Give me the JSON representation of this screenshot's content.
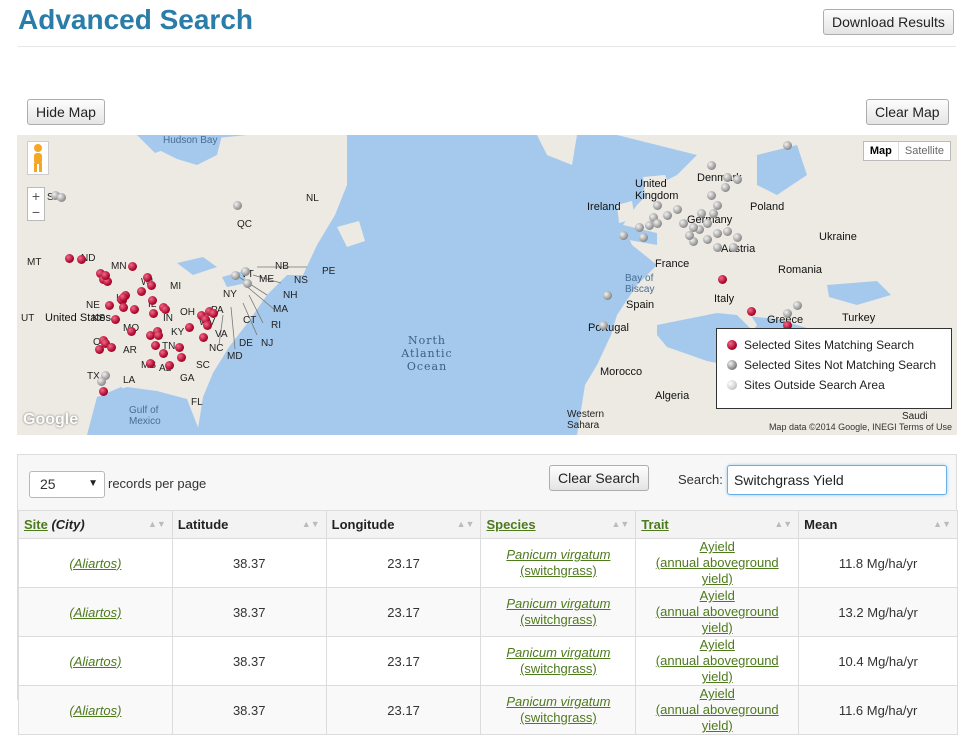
{
  "header": {
    "title": "Advanced Search",
    "download_label": "Download Results"
  },
  "map_toolbar": {
    "hide_label": "Hide Map",
    "clear_label": "Clear Map"
  },
  "map": {
    "map_type": {
      "map": "Map",
      "satellite": "Satellite"
    },
    "zoom_in": "+",
    "zoom_out": "−",
    "attribution": "Map data ©2014 Google, INEGI   Terms of Use",
    "logo": "Google",
    "labels": {
      "hudson_bay": "Hudson Bay",
      "qc": "QC",
      "nl": "NL",
      "sk": "SK",
      "mt": "MT",
      "nd": "ND",
      "mn": "MN",
      "wi": "WI",
      "mi": "MI",
      "ne": "NE",
      "ia": "IA",
      "il": "IL",
      "oh": "OH",
      "in": "IN",
      "ky": "KY",
      "ks": "KS",
      "mo": "MO",
      "tn": "TN",
      "ok": "OK",
      "ar": "AR",
      "ms": "MS",
      "al": "AL",
      "ga": "GA",
      "sc": "SC",
      "nc": "NC",
      "va": "VA",
      "wv": "WV",
      "pa": "PA",
      "ny": "NY",
      "ct": "CT",
      "nj": "NJ",
      "de": "DE",
      "md": "MD",
      "ri": "RI",
      "ma": "MA",
      "nh": "NH",
      "vt": "VT",
      "me": "ME",
      "nb": "NB",
      "ns": "NS",
      "pe": "PE",
      "tx": "TX",
      "la": "LA",
      "fl": "FL",
      "ut": "UT",
      "us": "United States",
      "gulf": "Gulf of Mexico",
      "ocean": "North Atlantic Ocean",
      "uk": "United Kingdom",
      "ireland": "Ireland",
      "denmark": "Denmark",
      "germany": "Germany",
      "poland": "Poland",
      "ukraine": "Ukraine",
      "france": "France",
      "austria": "Austria",
      "romania": "Romania",
      "italy": "Italy",
      "spain": "Spain",
      "portugal": "Portugal",
      "greece": "Greece",
      "turkey": "Turkey",
      "morocco": "Morocco",
      "algeria": "Algeria",
      "western_sahara": "Western Sahara",
      "bay_biscay": "Bay of Biscay",
      "saudi": "Saudi"
    },
    "legend": {
      "matching": "Selected Sites Matching Search",
      "not_matching": "Selected Sites Not Matching Search",
      "outside": "Sites Outside Search Area"
    },
    "colors": {
      "matching": "#c0083a",
      "not_matching": "#8c8c8c",
      "outside": "#d4d4d4",
      "water": "#a5c9ec",
      "land": "#eceae3"
    }
  },
  "table_controls": {
    "page_size": "25",
    "records_label": "records per page",
    "clear_search_label": "Clear Search",
    "search_label": "Search:",
    "search_value": "Switchgrass Yield"
  },
  "table": {
    "columns": {
      "site": "Site",
      "city": "(City)",
      "latitude": "Latitude",
      "longitude": "Longitude",
      "species": "Species",
      "trait": "Trait",
      "mean": "Mean"
    },
    "rows": [
      {
        "site": "(Aliartos)",
        "latitude": "38.37",
        "longitude": "23.17",
        "species_sci": "Panicum virgatum ",
        "species_common": "(switchgrass)",
        "trait": "Ayield",
        "trait_desc": "(annual aboveground yield)",
        "mean": "11.8 Mg/ha/yr"
      },
      {
        "site": "(Aliartos)",
        "latitude": "38.37",
        "longitude": "23.17",
        "species_sci": "Panicum virgatum ",
        "species_common": "(switchgrass)",
        "trait": "Ayield",
        "trait_desc": "(annual aboveground yield)",
        "mean": "13.2 Mg/ha/yr"
      },
      {
        "site": "(Aliartos)",
        "latitude": "38.37",
        "longitude": "23.17",
        "species_sci": "Panicum virgatum ",
        "species_common": "(switchgrass)",
        "trait": "Ayield",
        "trait_desc": "(annual aboveground yield)",
        "mean": "10.4 Mg/ha/yr"
      },
      {
        "site": "(Aliartos)",
        "latitude": "38.37",
        "longitude": "23.17",
        "species_sci": "Panicum virgatum ",
        "species_common": "(switchgrass)",
        "trait": "Ayield",
        "trait_desc": "(annual aboveground yield)",
        "mean": "11.6 Mg/ha/yr"
      }
    ]
  }
}
